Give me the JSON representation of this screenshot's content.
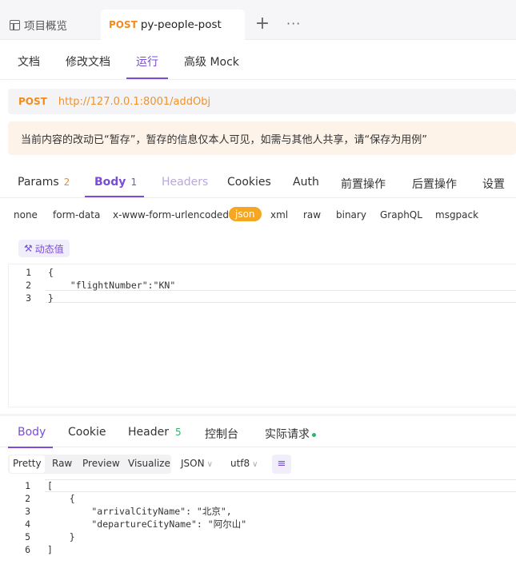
{
  "tabs": {
    "overview_label": "项目概览",
    "active_method": "POST",
    "active_title": "py-people-post",
    "add_symbol": "+",
    "more_symbol": "···"
  },
  "subnav": [
    "文档",
    "修改文档",
    "运行",
    "高级 Mock"
  ],
  "request": {
    "method": "POST",
    "url": "http://127.0.0.1:8001/addObj"
  },
  "notice": "当前内容的改动已“暂存”，暂存的信息仅本人可见，如需与其他人共享，请“保存为用例”",
  "request_tabs": [
    {
      "label": "Params",
      "count": "2"
    },
    {
      "label": "Body",
      "count": "1"
    },
    {
      "label": "Headers",
      "count": ""
    },
    {
      "label": "Cookies",
      "count": ""
    },
    {
      "label": "Auth",
      "count": ""
    },
    {
      "label": "前置操作",
      "count": ""
    },
    {
      "label": "后置操作",
      "count": ""
    },
    {
      "label": "设置",
      "count": ""
    }
  ],
  "body_types": [
    "none",
    "form-data",
    "x-www-form-urlencoded",
    "json",
    "xml",
    "raw",
    "binary",
    "GraphQL",
    "msgpack"
  ],
  "dynamic_value_label": "动态值",
  "request_body": [
    {
      "n": "1",
      "text": "{"
    },
    {
      "n": "2",
      "text": "    \"flightNumber\":\"KN\""
    },
    {
      "n": "3",
      "text": "}"
    }
  ],
  "response_tabs": [
    {
      "label": "Body",
      "count": ""
    },
    {
      "label": "Cookie",
      "count": ""
    },
    {
      "label": "Header",
      "count": "5"
    },
    {
      "label": "控制台",
      "count": ""
    },
    {
      "label": "实际请求",
      "count": ""
    }
  ],
  "response_view": [
    "Pretty",
    "Raw",
    "Preview",
    "Visualize"
  ],
  "response_format": "JSON",
  "response_encoding": "utf8",
  "response_body": [
    {
      "n": "1",
      "text": "["
    },
    {
      "n": "2",
      "text": "    {"
    },
    {
      "n": "3",
      "text": "        \"arrivalCityName\": \"北京\","
    },
    {
      "n": "4",
      "text": "        \"departureCityName\": \"阿尔山\""
    },
    {
      "n": "5",
      "text": "    }"
    },
    {
      "n": "6",
      "text": "]"
    }
  ],
  "colors": {
    "accent": "#7b4cd9",
    "method": "#f08c1e",
    "success": "#2fb36b",
    "json_pill": "#f5a623"
  }
}
